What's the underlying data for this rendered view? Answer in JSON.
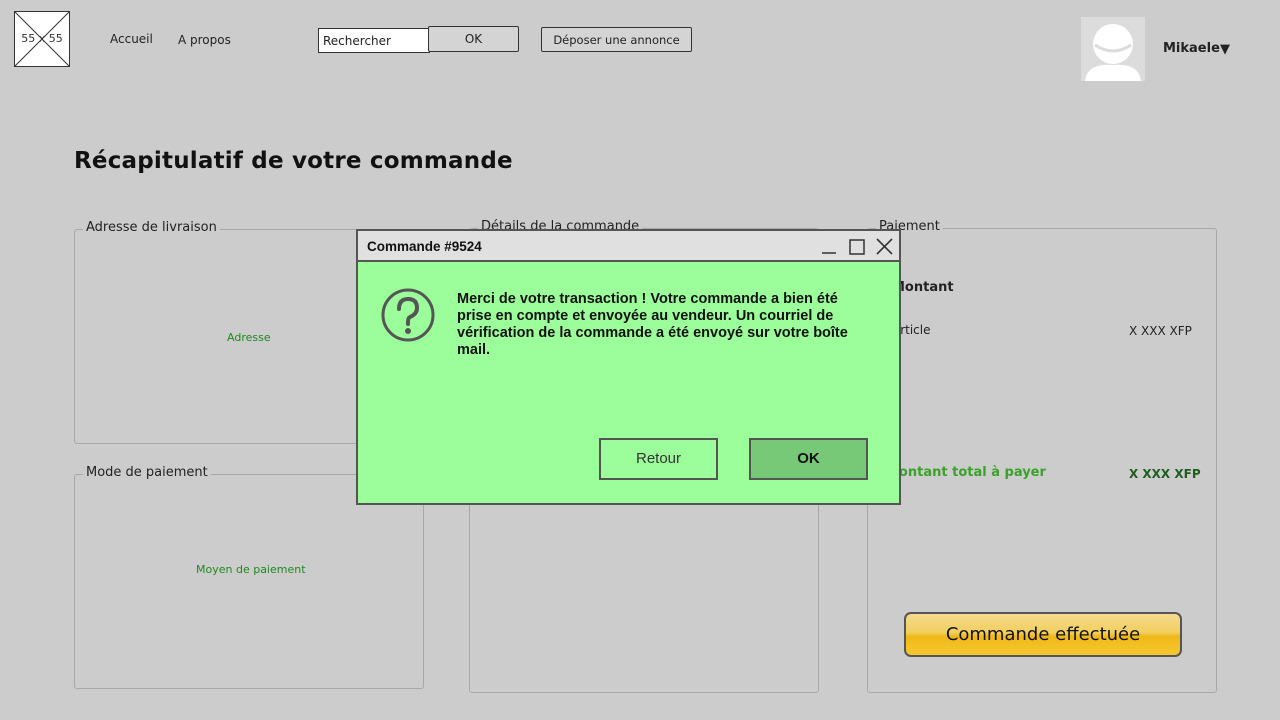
{
  "header": {
    "logo_text": "55 x 55",
    "nav": [
      "Accueil",
      "A propos"
    ],
    "search": {
      "value": "Rechercher",
      "button": "OK"
    },
    "deposit_button": "Déposer une annonce",
    "user": {
      "name": "Mikaele",
      "caret": "▼"
    }
  },
  "page_title": "Récapitulatif de votre commande",
  "panels": {
    "delivery": {
      "legend": "Adresse de livraison",
      "content": "Adresse"
    },
    "details": {
      "legend": "Détails de la commande"
    },
    "payment": {
      "legend": "Paiement",
      "amount_label": "Montant",
      "article_label": "Article",
      "article_value": "X XXX XFP",
      "total_label": "Montant total à payer",
      "total_value": "X XXX XFP"
    },
    "payment_mode": {
      "legend": "Mode de paiement",
      "content": "Moyen de paiement"
    }
  },
  "order_button": "Commande effectuée",
  "modal": {
    "title": "Commande #9524",
    "message": "Merci de votre transaction ! Votre commande a bien été prise en compte et envoyée au vendeur. Un courriel de vérification de la commande a été envoyé sur votre boîte mail.",
    "buttons": {
      "back": "Retour",
      "ok": "OK"
    }
  },
  "colors": {
    "modal_bg": "#9cfe9a",
    "ok_bg": "#77c877",
    "accent_green": "#3aa12a",
    "order_button": "#f0b818",
    "page_bg": "#cccccc"
  },
  "icons": [
    "question-icon",
    "minimize-icon",
    "maximize-icon",
    "close-icon",
    "avatar-placeholder-icon",
    "chevron-down-icon"
  ]
}
